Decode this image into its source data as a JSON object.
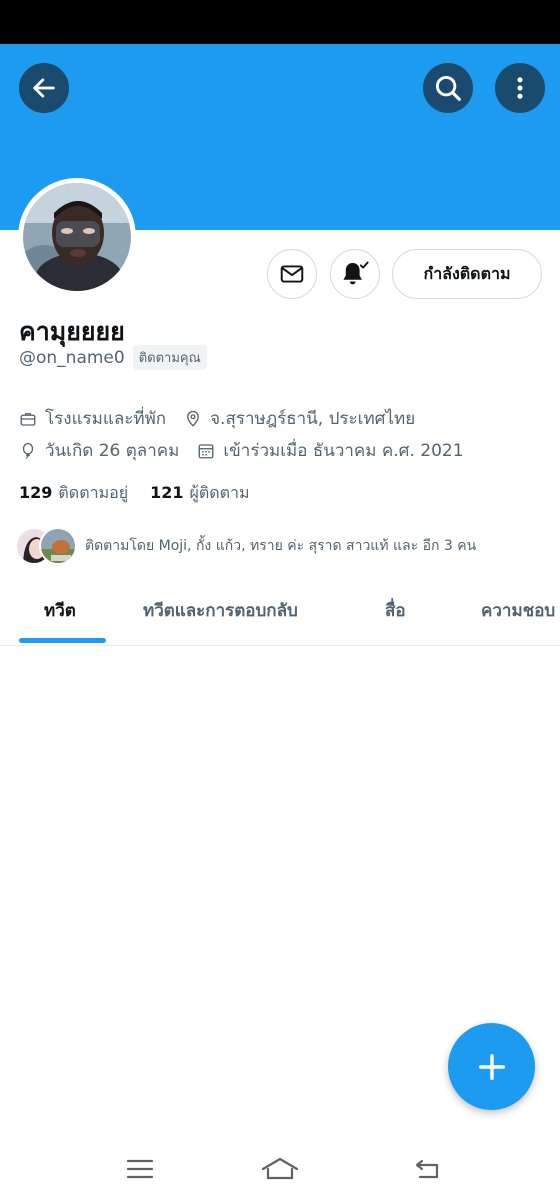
{
  "colors": {
    "banner": "#1d9bf0",
    "accent": "#1d9bf0",
    "header_button_bg": "#1a4a6e",
    "secondary_text": "#536471",
    "primary_text": "#0f1419"
  },
  "header": {
    "back_icon": "arrow-left-icon",
    "search_icon": "search-icon",
    "more_icon": "more-vertical-icon"
  },
  "profile": {
    "display_name": "คามุยยยย",
    "handle": "@on_name0",
    "follows_you_badge": "ติดตามคุณ",
    "follow_button_label": "กำลังติดตาม",
    "message_icon": "mail-icon",
    "notify_icon": "bell-check-icon",
    "category": "โรงแรมและที่พัก",
    "location": "จ.สุราษฎร์ธานี, ประเทศไทย",
    "birthday": "วันเกิด 26 ตุลาคม",
    "joined": "เข้าร่วมเมื่อ ธันวาคม ค.ศ. 2021",
    "following_count": "129",
    "following_label": "ติดตามอยู่",
    "followers_count": "121",
    "followers_label": "ผู้ติดตาม",
    "followed_by_text": "ติดตามโดย Moji, กั้ง แก้ว, ทราย ค่ะ สุราด สาวแท้ และ อีก 3 คน"
  },
  "tabs": [
    {
      "label": "ทวีต",
      "active": true
    },
    {
      "label": "ทวีตและการตอบกลับ",
      "active": false
    },
    {
      "label": "สื่อ",
      "active": false
    },
    {
      "label": "ความชอบ",
      "active": false
    }
  ],
  "fab": {
    "icon": "plus-icon"
  },
  "nav_bar": {
    "recent_icon": "menu-lines-icon",
    "home_icon": "home-icon",
    "back_icon": "back-return-icon"
  }
}
